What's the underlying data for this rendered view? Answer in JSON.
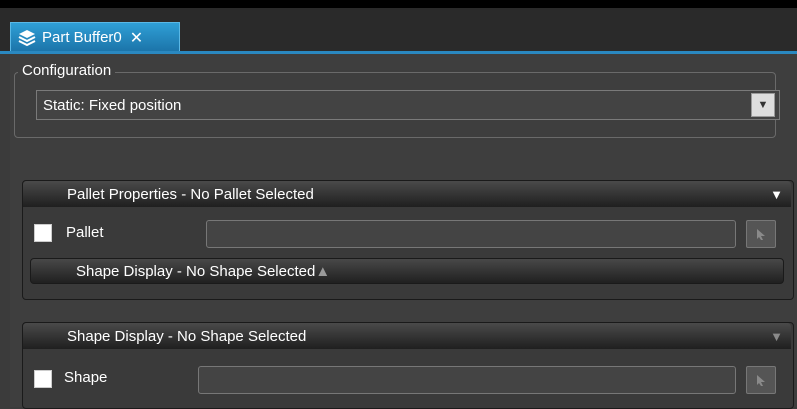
{
  "tab": {
    "title": "Part Buffer0",
    "close_label": "✕",
    "icon": "layers-icon"
  },
  "configuration": {
    "legend": "Configuration",
    "selected_value": "Static: Fixed position",
    "dropdown_arrow": "▼"
  },
  "pallet_properties": {
    "header": "Pallet Properties - No Pallet Selected",
    "arrow": "▼",
    "pallet_label": "Pallet",
    "pallet_value": "",
    "shape_display": {
      "header": "Shape Display - No Shape Selected",
      "arrow": "▲"
    }
  },
  "shape_display": {
    "header": "Shape Display - No Shape Selected",
    "arrow": "▼",
    "shape_label": "Shape",
    "shape_value": ""
  },
  "colors": {
    "accent": "#2a88c0",
    "background": "#3e3e3e"
  }
}
